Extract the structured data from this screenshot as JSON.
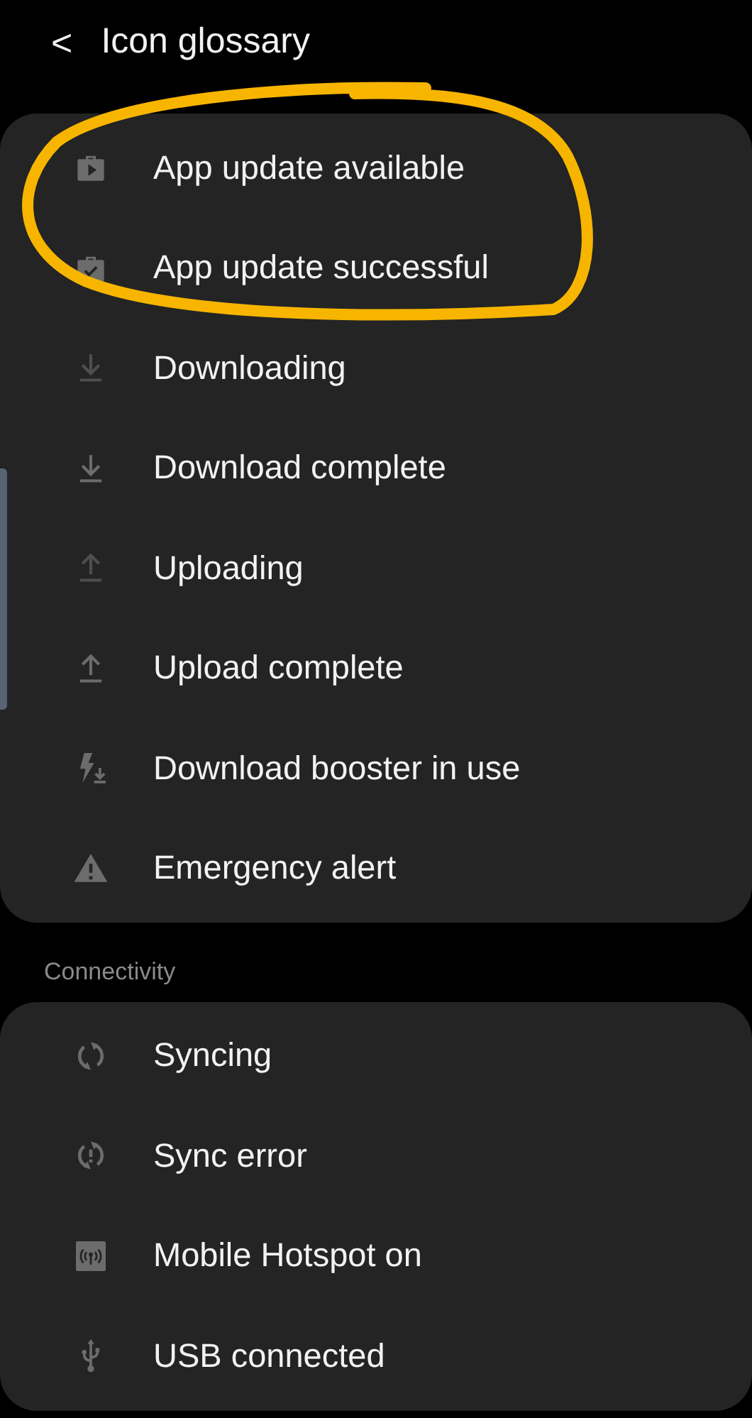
{
  "header": {
    "back_icon": "<",
    "title": "Icon glossary"
  },
  "groups": [
    {
      "items": [
        {
          "label": "App update available",
          "kind": "update"
        },
        {
          "label": "App update successful",
          "kind": "updated"
        },
        {
          "label": "Downloading",
          "kind": "downloading"
        },
        {
          "label": "Download complete",
          "kind": "downloaded"
        },
        {
          "label": "Uploading",
          "kind": "uploading"
        },
        {
          "label": "Upload complete",
          "kind": "uploaded"
        },
        {
          "label": "Download booster in use",
          "kind": "booster"
        },
        {
          "label": "Emergency alert",
          "kind": "alert"
        }
      ]
    },
    {
      "title": "Connectivity",
      "items": [
        {
          "label": "Syncing",
          "kind": "syncing"
        },
        {
          "label": "Sync error",
          "kind": "syncerror"
        },
        {
          "label": "Mobile Hotspot on",
          "kind": "hotspot"
        },
        {
          "label": "USB connected",
          "kind": "usb"
        }
      ]
    }
  ]
}
